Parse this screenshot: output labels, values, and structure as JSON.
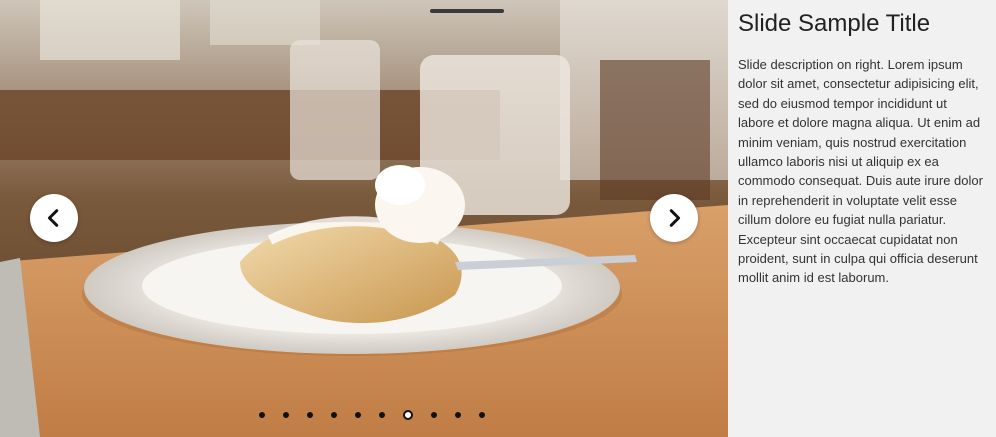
{
  "slide": {
    "title": "Slide Sample Title",
    "description": "Slide description on right. Lorem ipsum dolor sit amet, consectetur adipisicing elit, sed do eiusmod tempor incididunt ut labore et dolore magna aliqua. Ut enim ad minim veniam, quis nostrud exercitation ullamco laboris nisi ut aliquip ex ea commodo consequat. Duis aute irure dolor in reprehenderit in voluptate velit esse cillum dolore eu fugiat nulla pariatur. Excepteur sint occaecat cupidatat non proident, sunt in culpa qui officia deserunt mollit anim id est laborum."
  },
  "navigation": {
    "prev_icon": "chevron-left-icon",
    "next_icon": "chevron-right-icon"
  },
  "pagination": {
    "total": 10,
    "active_index": 6
  },
  "image": {
    "subject": "pastry on plate with whipped cream and fork"
  },
  "colors": {
    "panel_background": "#f1f1f1",
    "button_background": "#ffffff",
    "dot_color": "#111111"
  }
}
